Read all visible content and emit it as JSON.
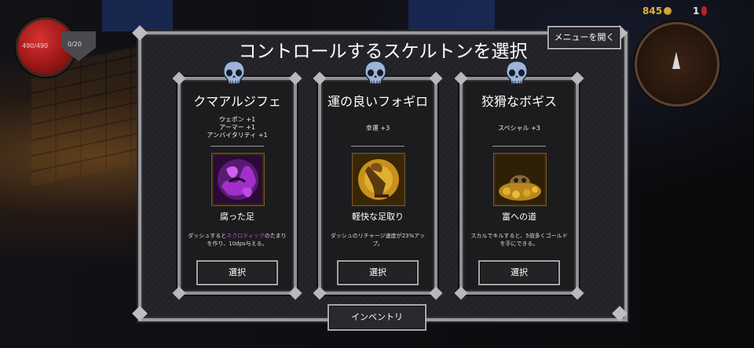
{
  "hud": {
    "health": "490/490",
    "armor": "0/20",
    "gold": "845",
    "keys": "1"
  },
  "dialog": {
    "title": "コントロールするスケルトンを選択",
    "menu_button": "メニューを開く",
    "inventory_button": "インベントリ"
  },
  "cards": [
    {
      "name": "クマアルジフェ",
      "stats": [
        "ウェポン +1",
        "アーマー +1",
        "アンバイタリティ +1"
      ],
      "ability_name": "腐った足",
      "ability_desc_pre": "ダッシュすると",
      "ability_desc_highlight": "ネクロティック",
      "ability_desc_post": "のたまりを作り、10dps与える。",
      "select_label": "選択",
      "icon": "rotten-foot-icon"
    },
    {
      "name": "運の良いフォギロ",
      "stats": [
        "幸運 +3"
      ],
      "ability_name": "軽快な足取り",
      "ability_desc": "ダッシュのリチャージ速度が23%アップ。",
      "select_label": "選択",
      "icon": "light-step-icon"
    },
    {
      "name": "狡猾なボギス",
      "stats": [
        "スペシャル +3"
      ],
      "ability_name": "富への道",
      "ability_desc": "スカルでキルすると、5倍多くゴールドを手にできる。",
      "select_label": "選択",
      "icon": "road-to-riches-icon"
    }
  ],
  "colors": {
    "highlight": "#c54ad8",
    "gold": "#e0b53a",
    "health": "#c62828"
  }
}
